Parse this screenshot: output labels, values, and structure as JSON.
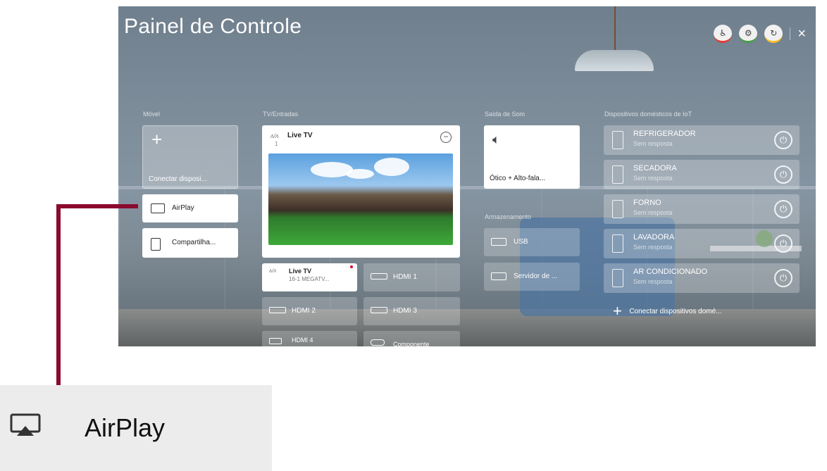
{
  "screen": {
    "title": "Painel de Controle",
    "top_icons": [
      {
        "name": "accessibility-icon",
        "color": "#e53935"
      },
      {
        "name": "settings-icon",
        "color": "#43a047"
      },
      {
        "name": "refresh-icon",
        "color": "#fbc02d"
      }
    ],
    "close_label": "×"
  },
  "sections": {
    "mobile": "Móvel",
    "tv_inputs": "TV/Entradas",
    "sound_out": "Saída de Som",
    "storage": "Armazenamento",
    "iot": "Dispositivos domésticos de IoT"
  },
  "mobile": {
    "connect_plus": "+",
    "connect_label": "Conectar disposi...",
    "airplay_label": "AirPlay",
    "share_label": "Compartilha..."
  },
  "live_tv": {
    "label": "Live TV",
    "channel": "1",
    "minus": "−"
  },
  "inputs": {
    "live_tv_small": "Live TV",
    "live_tv_channel": "16-1 MEGATV...",
    "hdmi1": "HDMI 1",
    "hdmi2": "HDMI 2",
    "hdmi3": "HDMI 3",
    "hdmi4": "HDMI 4",
    "component": "Componente"
  },
  "sound": {
    "output_label": "Ótico + Alto-fala..."
  },
  "storage": {
    "usb": "USB",
    "server": "Servidor de ..."
  },
  "appliances": [
    {
      "name": "REFRIGERADOR",
      "status": "Sem resposta"
    },
    {
      "name": "SECADORA",
      "status": "Sem resposta"
    },
    {
      "name": "FORNO",
      "status": "Sem resposta"
    },
    {
      "name": "LAVADORA",
      "status": "Sem resposta"
    },
    {
      "name": "AR CONDICIONADO",
      "status": "Sem resposta"
    }
  ],
  "iot_connect": {
    "plus": "+",
    "label": "Conectar dispositivos domé..."
  },
  "callout": {
    "label": "AirPlay",
    "line_color": "#8b0a2e"
  }
}
